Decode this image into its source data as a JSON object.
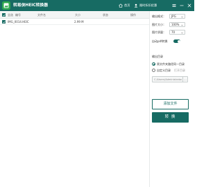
{
  "app": {
    "title": "转易侠HEIC转换器",
    "nav_home": "首页",
    "nav_promo": "限时折扣优惠"
  },
  "table": {
    "headers": {
      "select": "全选",
      "number": "编号",
      "filename": "文件名",
      "size": "大小",
      "status": "状态",
      "action": "操作"
    },
    "rows": [
      {
        "filename": "IMG_0014.HEIC",
        "size": "2.99 M",
        "checked": true
      }
    ]
  },
  "settings": {
    "format_label": "输出格式：",
    "format_value": "JPG",
    "img_size_label": "图片大小：",
    "img_size_value": "100%",
    "img_quality_label": "图片质量：",
    "img_quality_value": "70",
    "auto_pdf_label": "自动pdf转换",
    "auto_pdf_on": true,
    "output_dir_title": "输出目录",
    "output_same_label": "原文件夹路径同一目录",
    "output_custom_label": "自定义目录",
    "open_folder_label": "打开目录",
    "output_selected": "same",
    "path_value": "C:/Users/Administrator",
    "path_browse": "..."
  },
  "buttons": {
    "add_files": "添加文件",
    "convert": "转 换"
  },
  "colors": {
    "brand": "#176b63",
    "background": "#ffffff"
  }
}
